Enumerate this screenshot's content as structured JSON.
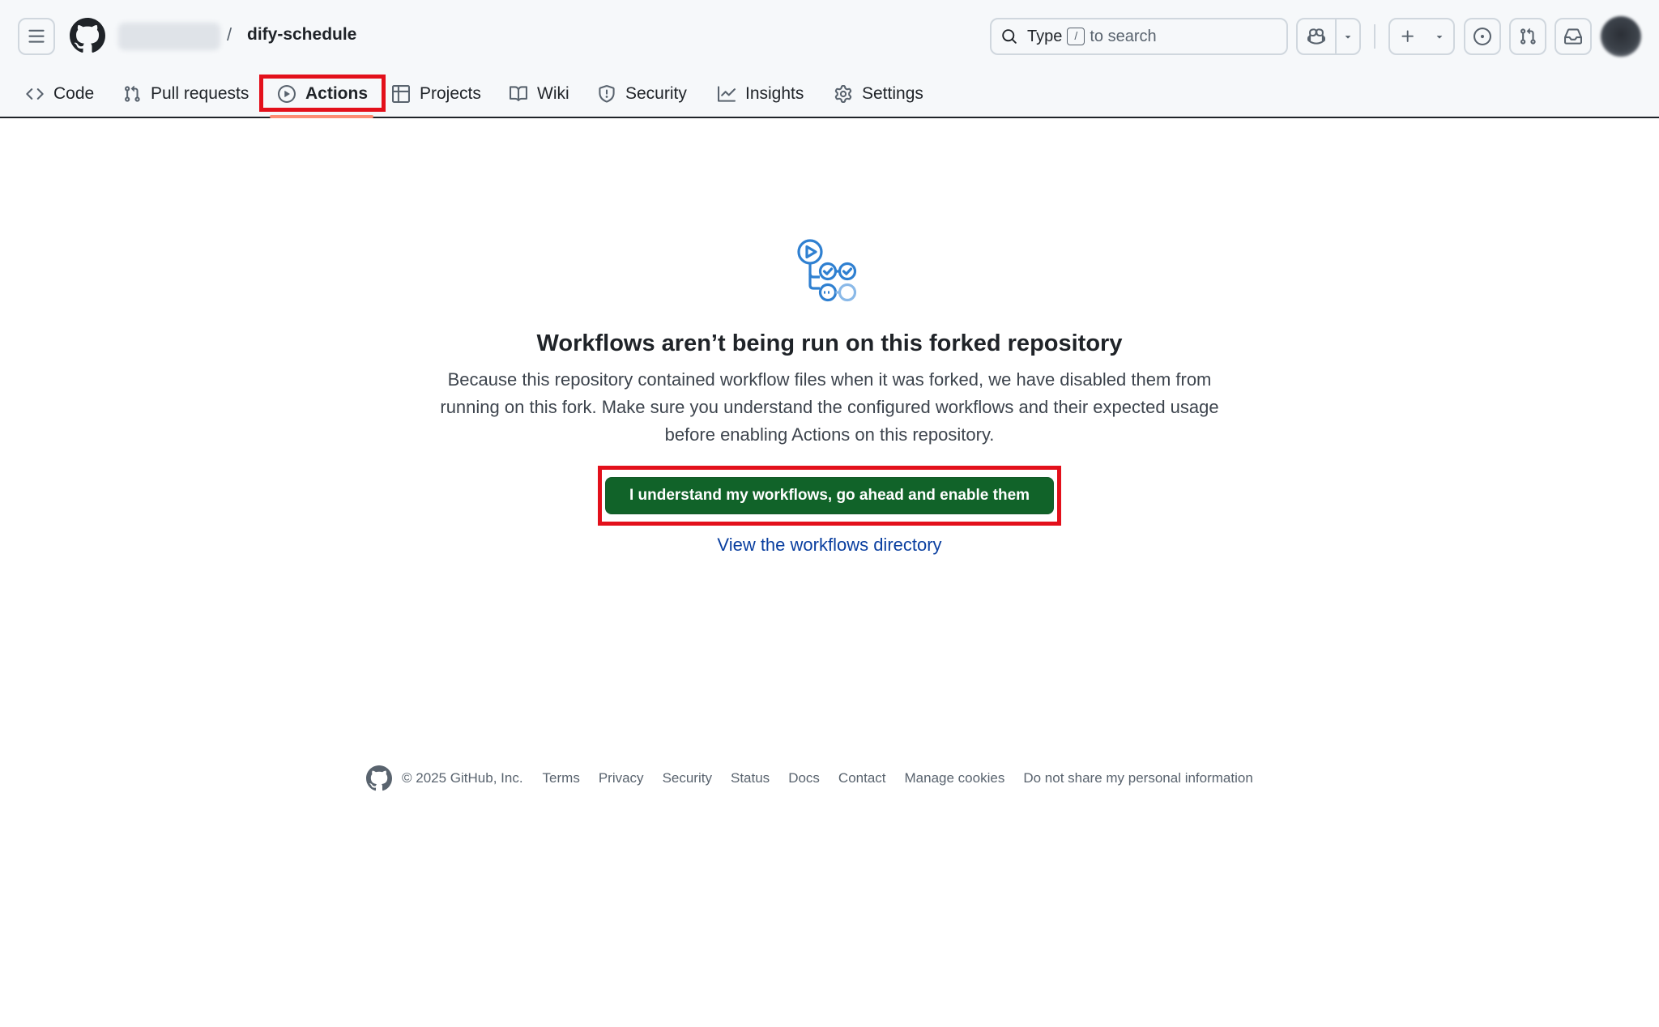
{
  "header": {
    "repo_name": "dify-schedule",
    "separator": "/",
    "search": {
      "prefix": "Type",
      "key": "/",
      "suffix": "to search"
    }
  },
  "tabs": [
    {
      "label": "Code",
      "icon": "code-icon"
    },
    {
      "label": "Pull requests",
      "icon": "git-pull-request-icon"
    },
    {
      "label": "Actions",
      "icon": "play-icon",
      "selected": true
    },
    {
      "label": "Projects",
      "icon": "table-icon"
    },
    {
      "label": "Wiki",
      "icon": "book-icon"
    },
    {
      "label": "Security",
      "icon": "shield-icon"
    },
    {
      "label": "Insights",
      "icon": "graph-icon"
    },
    {
      "label": "Settings",
      "icon": "gear-icon"
    }
  ],
  "blankslate": {
    "icon": "workflow-icon",
    "title": "Workflows aren’t being run on this forked repository",
    "description": "Because this repository contained workflow files when it was forked, we have disabled them from running on this fork. Make sure you understand the configured workflows and their expected usage before enabling Actions on this repository.",
    "enable_button": "I understand my workflows, go ahead and enable them",
    "workflows_link": "View the workflows directory"
  },
  "footer": {
    "copyright": "© 2025 GitHub, Inc.",
    "links": [
      "Terms",
      "Privacy",
      "Security",
      "Status",
      "Docs",
      "Contact",
      "Manage cookies",
      "Do not share my personal information"
    ]
  },
  "colors": {
    "primary_button": "#116329",
    "link": "#0a3fa0",
    "highlight_annotation": "#e3101b",
    "selected_tab_underline": "#fd8c73"
  }
}
